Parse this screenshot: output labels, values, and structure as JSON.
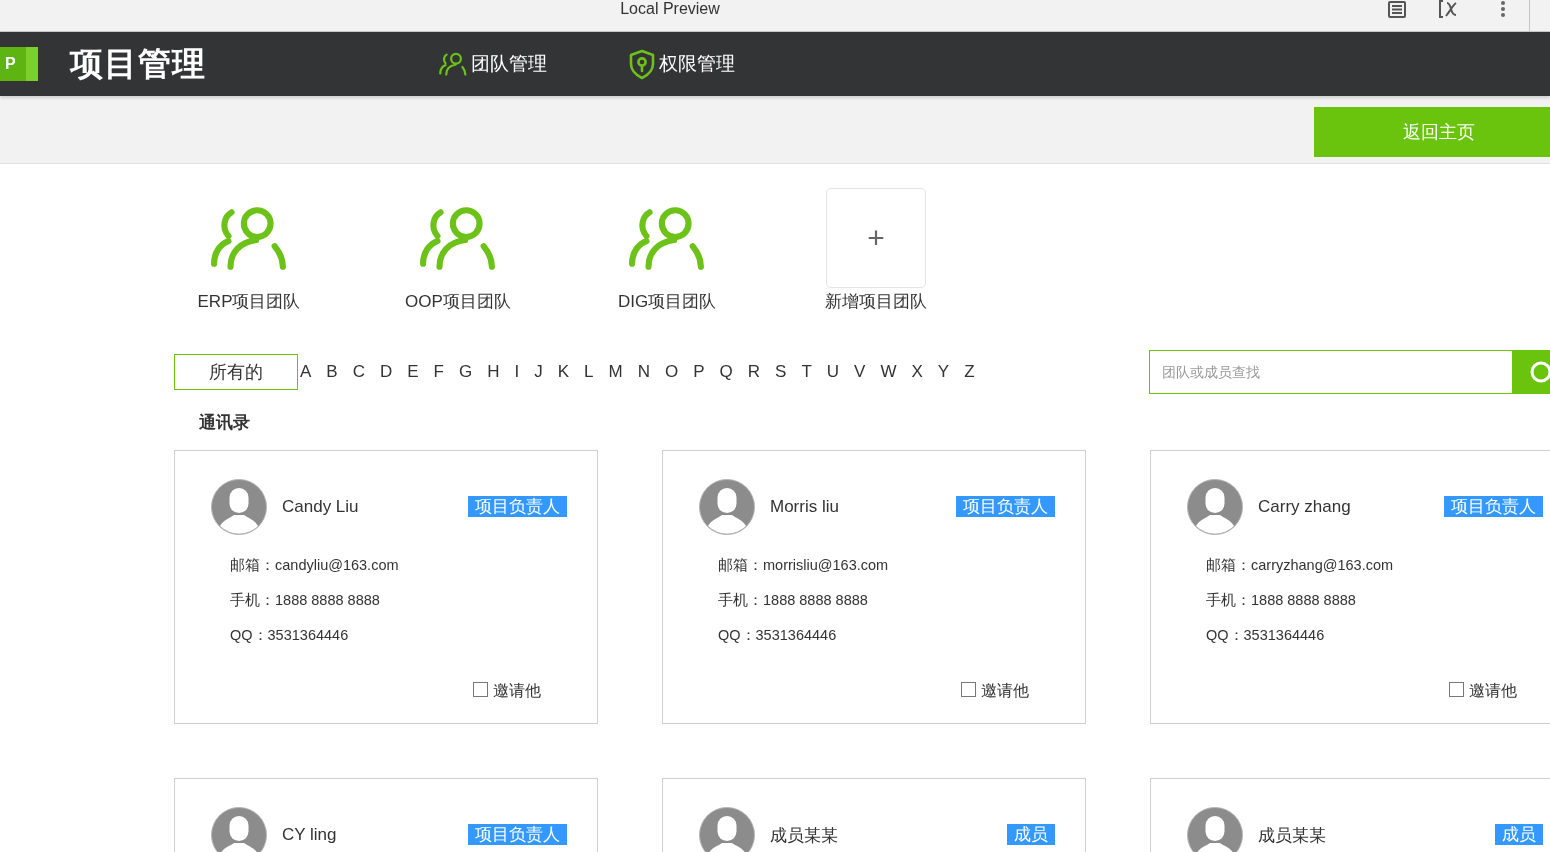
{
  "browser": {
    "title": "Local Preview"
  },
  "header": {
    "logo_letter": "P",
    "app_title": "项目管理",
    "nav": [
      {
        "label": "团队管理",
        "kind": "team"
      },
      {
        "label": "权限管理",
        "kind": "shield"
      }
    ]
  },
  "toolbar": {
    "back_button": "返回主页"
  },
  "teams": [
    {
      "name": "ERP项目团队",
      "kind": "team"
    },
    {
      "name": "OOP项目团队",
      "kind": "team"
    },
    {
      "name": "DIG项目团队",
      "kind": "team"
    },
    {
      "name": "新增项目团队",
      "kind": "add",
      "symbol": "+"
    }
  ],
  "filter": {
    "letters": [
      {
        "label": "所有的",
        "selected": true
      },
      {
        "label": "A",
        "selected": false
      },
      {
        "label": "B",
        "selected": false
      },
      {
        "label": "C",
        "selected": false
      },
      {
        "label": "D",
        "selected": false
      },
      {
        "label": "E",
        "selected": false
      },
      {
        "label": "F",
        "selected": false
      },
      {
        "label": "G",
        "selected": false
      },
      {
        "label": "H",
        "selected": false
      },
      {
        "label": "I",
        "selected": false
      },
      {
        "label": "J",
        "selected": false
      },
      {
        "label": "K",
        "selected": false
      },
      {
        "label": "L",
        "selected": false
      },
      {
        "label": "M",
        "selected": false
      },
      {
        "label": "N",
        "selected": false
      },
      {
        "label": "O",
        "selected": false
      },
      {
        "label": "P",
        "selected": false
      },
      {
        "label": "Q",
        "selected": false
      },
      {
        "label": "R",
        "selected": false
      },
      {
        "label": "S",
        "selected": false
      },
      {
        "label": "T",
        "selected": false
      },
      {
        "label": "U",
        "selected": false
      },
      {
        "label": "V",
        "selected": false
      },
      {
        "label": "W",
        "selected": false
      },
      {
        "label": "X",
        "selected": false
      },
      {
        "label": "Y",
        "selected": false
      },
      {
        "label": "Z",
        "selected": false
      }
    ]
  },
  "search": {
    "placeholder": "团队或成员查找"
  },
  "contacts": {
    "title": "通讯录",
    "cards": [
      {
        "name": "Candy Liu",
        "role": "项目负责人",
        "email_label": "邮箱：",
        "email": "candyliu@163.com",
        "phone_label": "手机：",
        "phone": "1888 8888 8888",
        "qq_label": "QQ：",
        "qq": "3531364446",
        "invite_label": "邀请他",
        "invited": false
      },
      {
        "name": "Morris liu",
        "role": "项目负责人",
        "email_label": "邮箱：",
        "email": "morrisliu@163.com",
        "phone_label": "手机：",
        "phone": "1888 8888 8888",
        "qq_label": "QQ：",
        "qq": "3531364446",
        "invite_label": "邀请他",
        "invited": false
      },
      {
        "name": "Carry zhang",
        "role": "项目负责人",
        "email_label": "邮箱：",
        "email": "carryzhang@163.com",
        "phone_label": "手机：",
        "phone": "1888 8888 8888",
        "qq_label": "QQ：",
        "qq": "3531364446",
        "invite_label": "邀请他",
        "invited": false
      },
      {
        "name": "CY ling",
        "role": "项目负责人"
      },
      {
        "name": "成员某某",
        "role": "成员"
      },
      {
        "name": "成员某某",
        "role": "成员"
      }
    ]
  }
}
